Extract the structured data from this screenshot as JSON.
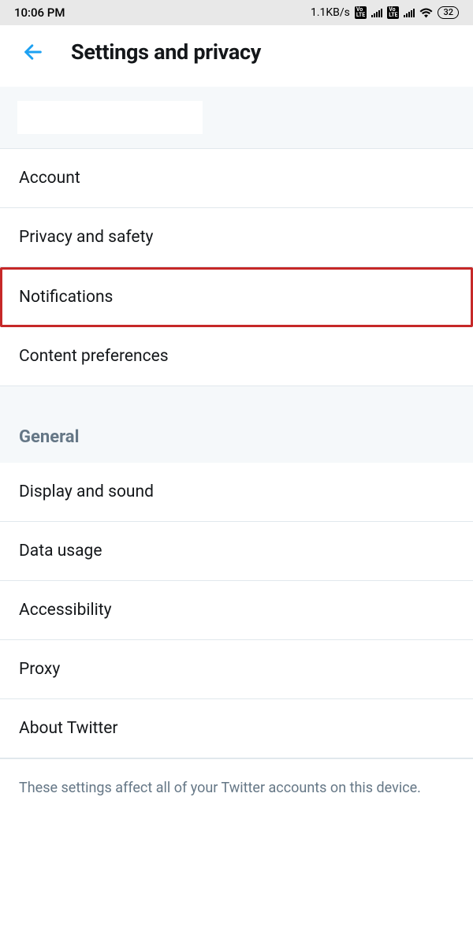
{
  "status": {
    "time": "10:06 PM",
    "speed": "1.1KB/s",
    "battery": "32"
  },
  "header": {
    "title": "Settings and privacy"
  },
  "items": {
    "account": "Account",
    "privacy": "Privacy and safety",
    "notifications": "Notifications",
    "content": "Content preferences"
  },
  "section": {
    "general": "General"
  },
  "general_items": {
    "display": "Display and sound",
    "data": "Data usage",
    "accessibility": "Accessibility",
    "proxy": "Proxy",
    "about": "About Twitter"
  },
  "footer": {
    "note": "These settings affect all of your Twitter accounts on this device."
  }
}
